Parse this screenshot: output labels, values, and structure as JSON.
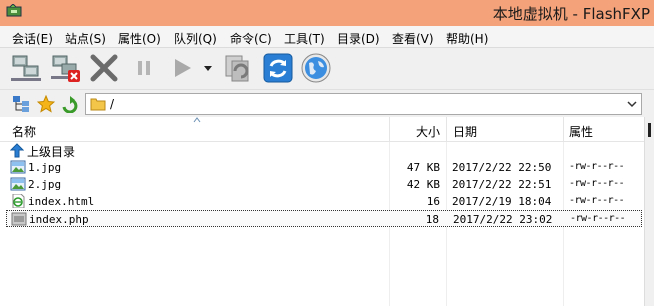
{
  "window": {
    "title": "本地虚拟机 - FlashFXP"
  },
  "menu": {
    "items": [
      {
        "label": "会话(E)"
      },
      {
        "label": "站点(S)"
      },
      {
        "label": "属性(O)"
      },
      {
        "label": "队列(Q)"
      },
      {
        "label": "命令(C)"
      },
      {
        "label": "工具(T)"
      },
      {
        "label": "目录(D)"
      },
      {
        "label": "查看(V)"
      },
      {
        "label": "帮助(H)"
      }
    ]
  },
  "toolbar": {
    "icons": [
      "connect-icon",
      "disconnect-icon",
      "abort-icon",
      "pause-icon",
      "transfer-icon",
      "transfer-options-icon",
      "compare-icon",
      "refresh-icon",
      "browser-icon"
    ]
  },
  "addressbar": {
    "path": "/",
    "icons": [
      "tree-view-icon",
      "favorites-star-icon",
      "go-up-icon",
      "folder-icon",
      "chevron-down-icon"
    ]
  },
  "list": {
    "columns": {
      "name": "名称",
      "size": "大小",
      "date": "日期",
      "attr": "属性"
    },
    "parent": {
      "label": "上级目录"
    },
    "files": [
      {
        "name": "1.jpg",
        "size": "47 KB",
        "date": "2017/2/22 22:50",
        "attr": "-rw-r--r--",
        "icon": "image-file-icon"
      },
      {
        "name": "2.jpg",
        "size": "42 KB",
        "date": "2017/2/22 22:51",
        "attr": "-rw-r--r--",
        "icon": "image-file-icon"
      },
      {
        "name": "index.html",
        "size": "16",
        "date": "2017/2/19 18:04",
        "attr": "-rw-r--r--",
        "icon": "html-file-icon"
      },
      {
        "name": "index.php",
        "size": "18",
        "date": "2017/2/22 23:02",
        "attr": "-rw-r--r--",
        "icon": "php-file-icon"
      }
    ]
  },
  "colors": {
    "titlebar": "#f3a27a",
    "selection_border": "#333333",
    "accent_blue": "#2a7fd4"
  }
}
